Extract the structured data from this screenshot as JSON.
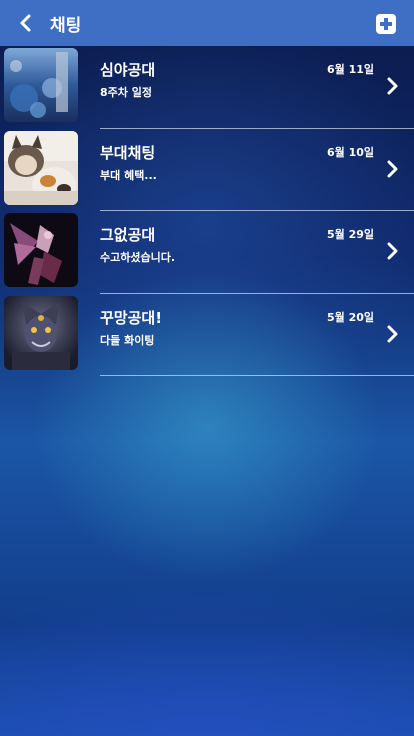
{
  "header": {
    "title": "채팅",
    "back_icon": "chevron-left-icon",
    "add_icon": "plus-square-icon"
  },
  "chats": [
    {
      "name": "심야공대",
      "preview": "8주차 일정",
      "date": "6월 11일",
      "avatar": "fantasy-scene-avatar"
    },
    {
      "name": "부대채팅",
      "preview": "부대 혜택...",
      "date": "6월 10일",
      "avatar": "cats-photo-avatar"
    },
    {
      "name": "그없공대",
      "preview": "수고하셨습니다.",
      "date": "5월 29일",
      "avatar": "winged-knight-avatar"
    },
    {
      "name": "꾸망공대!",
      "preview": "다들 화이팅",
      "date": "5월 20일",
      "avatar": "armored-demon-avatar"
    }
  ],
  "colors": {
    "header_bg": "#3f6fc4",
    "text": "#ffffff"
  }
}
